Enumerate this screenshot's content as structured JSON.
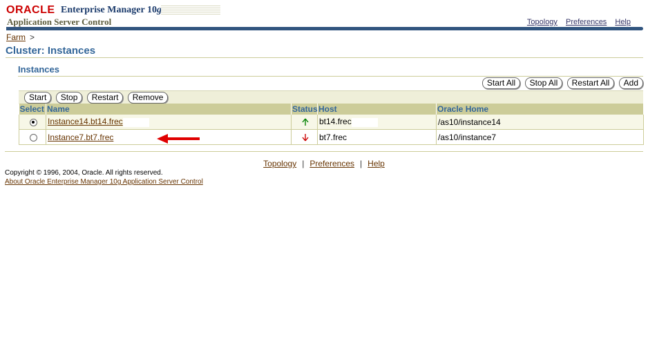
{
  "header": {
    "oracle_logo": "ORACLE",
    "product_name": "Enterprise Manager 10",
    "product_version": "g",
    "subtitle": "Application Server Control",
    "links": [
      "Topology",
      "Preferences",
      "Help"
    ]
  },
  "breadcrumb": {
    "farm": "Farm",
    "separator": ">"
  },
  "page_title": "Cluster: Instances",
  "section_title": "Instances",
  "top_buttons": [
    "Start All",
    "Stop All",
    "Restart All",
    "Add"
  ],
  "row_actions": [
    "Start",
    "Stop",
    "Restart",
    "Remove"
  ],
  "table": {
    "columns": [
      "Select",
      "Name",
      "Status",
      "Host",
      "Oracle Home"
    ],
    "rows": [
      {
        "name": "Instance14.bt14.frec",
        "status": "up",
        "host": "bt14.frec",
        "oracle_home": "/as10/instance14",
        "selected": true
      },
      {
        "name": "Instance7.bt7.frec",
        "status": "down",
        "host": "bt7.frec",
        "oracle_home": "/as10/instance7",
        "selected": false
      }
    ]
  },
  "colors": {
    "up": "#008000",
    "down": "#cc0000",
    "annotation": "#e00000"
  },
  "footer": {
    "links": [
      "Topology",
      "Preferences",
      "Help"
    ],
    "separator": "|",
    "copyright": "Copyright © 1996, 2004, Oracle. All rights reserved.",
    "about": "About Oracle Enterprise Manager 10g Application Server Control"
  }
}
